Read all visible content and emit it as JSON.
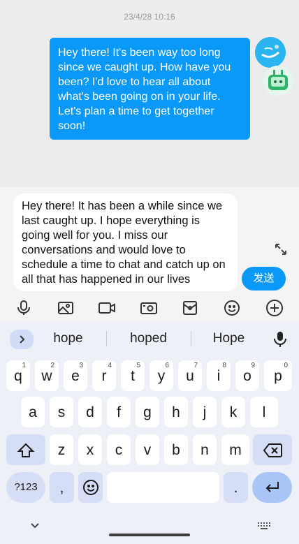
{
  "chat": {
    "timestamp": "23/4/28 10:16",
    "outgoing_message": "Hey there! It's been way too long since we caught up. How have you been? I'd love to hear all about what's been going on in your life. Let's plan a time to get together soon!"
  },
  "composer": {
    "input_value": "Hey there! It has been a while since we last caught up. I hope everything is going well for you. I miss our conversations and would love to schedule a time to chat and catch up on all that has happened in our lives",
    "send_label": "发送"
  },
  "toolbar": {
    "icons": [
      "mic-icon",
      "image-icon",
      "video-icon",
      "camera-icon",
      "red-packet-icon",
      "emoji-icon",
      "add-icon"
    ]
  },
  "keyboard": {
    "suggestions": [
      "hope",
      "hoped",
      "Hope"
    ],
    "row1": [
      {
        "k": "q",
        "h": "1"
      },
      {
        "k": "w",
        "h": "2"
      },
      {
        "k": "e",
        "h": "3"
      },
      {
        "k": "r",
        "h": "4"
      },
      {
        "k": "t",
        "h": "5"
      },
      {
        "k": "y",
        "h": "6"
      },
      {
        "k": "u",
        "h": "7"
      },
      {
        "k": "i",
        "h": "8"
      },
      {
        "k": "o",
        "h": "9"
      },
      {
        "k": "p",
        "h": "0"
      }
    ],
    "row2": [
      "a",
      "s",
      "d",
      "f",
      "g",
      "h",
      "j",
      "k",
      "l"
    ],
    "row3": [
      "z",
      "x",
      "c",
      "v",
      "b",
      "n",
      "m"
    ],
    "symbols_label": "?123",
    "comma_label": ",",
    "period_label": "."
  },
  "colors": {
    "accent": "#0a99f7",
    "keyboard_bg": "#eef0f7",
    "modifier_key": "#d6def6",
    "enter_key": "#a9c5f8"
  }
}
